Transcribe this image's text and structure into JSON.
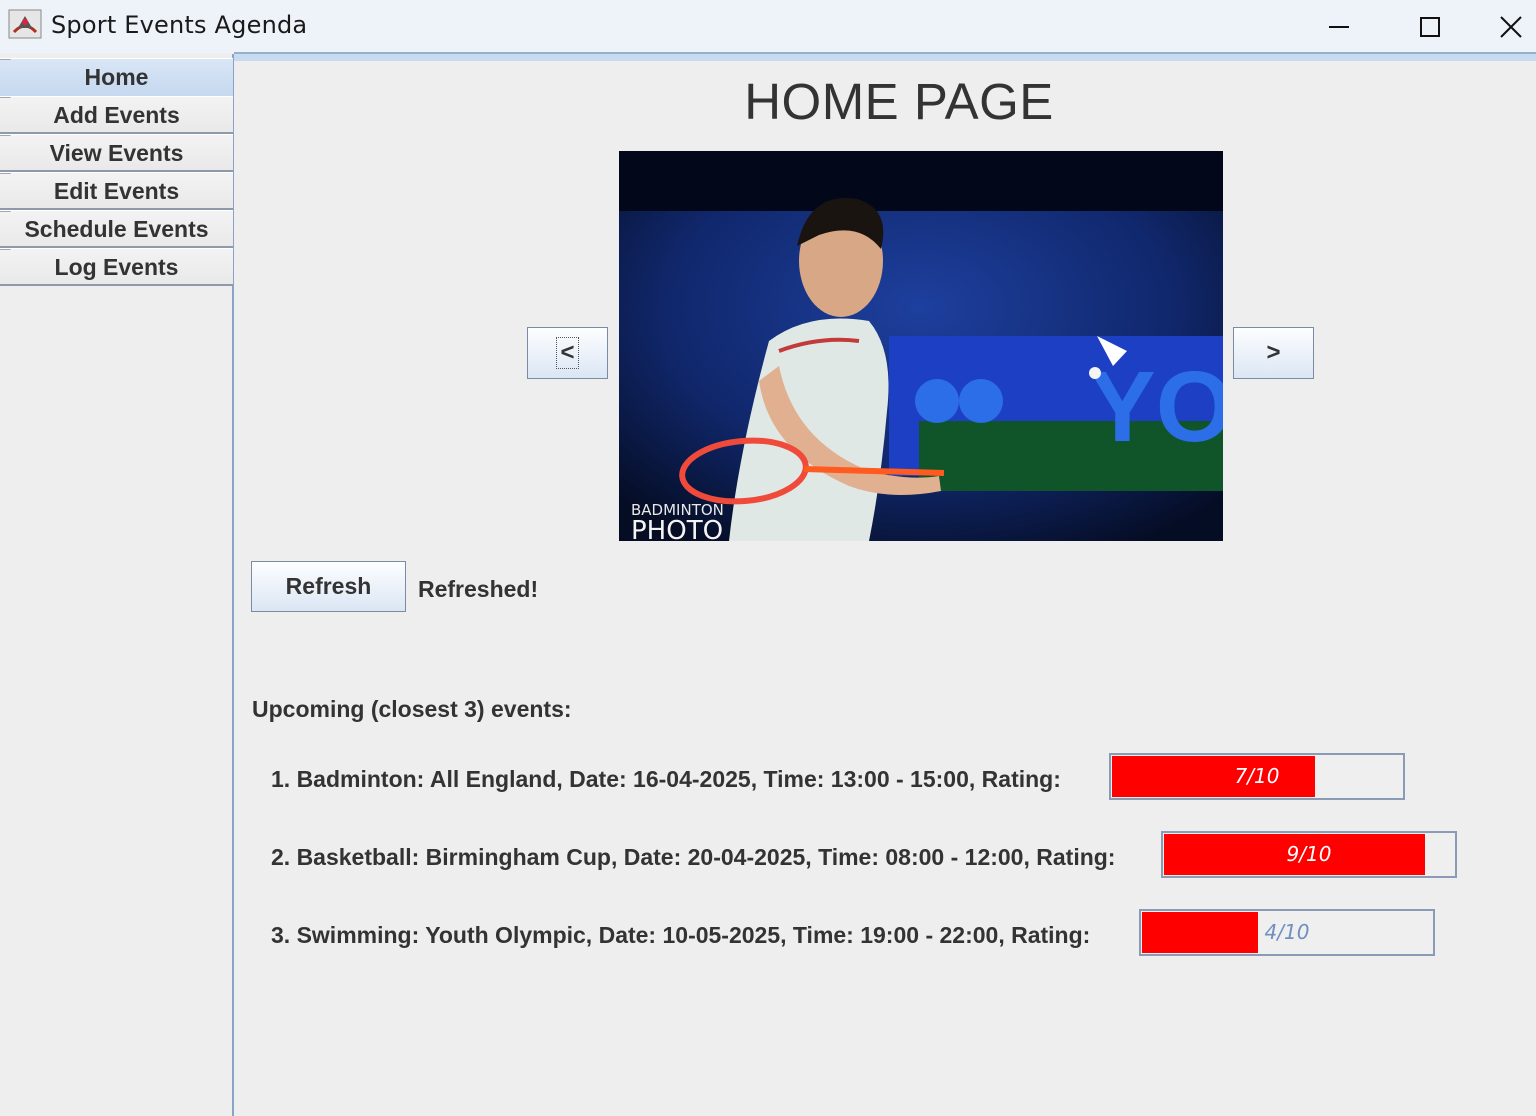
{
  "window": {
    "title": "Sport Events Agenda",
    "icon": "java-app-icon"
  },
  "sidebar": {
    "tabs": [
      {
        "label": "Home",
        "active": true
      },
      {
        "label": "Add Events",
        "active": false
      },
      {
        "label": "View Events",
        "active": false
      },
      {
        "label": "Edit Events",
        "active": false
      },
      {
        "label": "Schedule Events",
        "active": false
      },
      {
        "label": "Log Events",
        "active": false
      }
    ]
  },
  "main": {
    "title": "HOME PAGE",
    "carousel": {
      "prev_label": "<",
      "next_label": ">",
      "photo_caption_top": "BADMINTON",
      "photo_caption_bottom": "PHOTO",
      "photo_sign": "YO"
    },
    "refresh_label": "Refresh",
    "refresh_status": "Refreshed!",
    "upcoming_title": "Upcoming (closest 3) events:",
    "events": [
      {
        "text": "1. Badminton: All England, Date: 16-04-2025, Time: 13:00 - 15:00, Rating:",
        "rating_label": "7/10",
        "rating": 0.7
      },
      {
        "text": "2. Basketball: Birmingham Cup, Date: 20-04-2025, Time: 08:00 - 12:00, Rating:",
        "rating_label": "9/10",
        "rating": 0.9
      },
      {
        "text": "3. Swimming: Youth Olympic, Date: 10-05-2025, Time: 19:00 - 22:00, Rating:",
        "rating_label": "4/10",
        "rating": 0.4
      }
    ]
  },
  "colors": {
    "rating_fill": "#ff0000",
    "rating_text_on_fill": "#ffffff",
    "rating_text_off_fill": "#6f8fc0",
    "tab_active": "#c6d9ef"
  }
}
